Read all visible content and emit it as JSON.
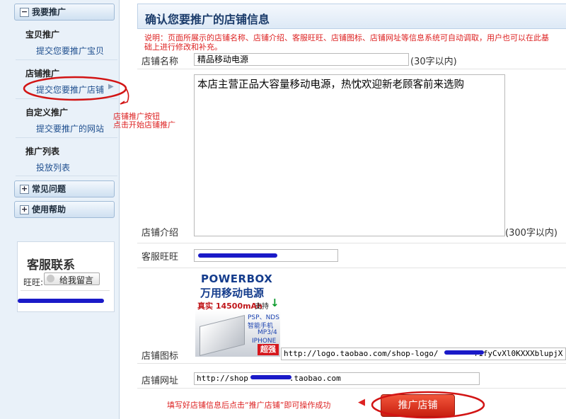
{
  "sidebar": {
    "promote_header": "我要推广",
    "sections": [
      {
        "title": "宝贝推广",
        "link": "提交您要推广宝贝"
      },
      {
        "title": "店铺推广",
        "link": "提交您要推广店铺"
      },
      {
        "title": "自定义推广",
        "link": "提交要推广的网站"
      },
      {
        "title": "推广列表",
        "link": "投放列表"
      }
    ],
    "faq_header": "常见问题",
    "help_header": "使用帮助",
    "customer_service": {
      "title": "客服联系",
      "wangwang_label": "旺旺:",
      "message_button": "给我留言"
    }
  },
  "annotations": {
    "button_note_line1": "店铺推广按钮",
    "button_note_line2": "点击开始店铺推广",
    "bottom_note": "填写好店铺信息后点击“推广店铺”即可操作成功"
  },
  "main": {
    "title": "确认您要推广的店铺信息",
    "notice": "说明：页面所展示的店铺名称、店铺介绍、客服旺旺、店铺图标、店铺网址等信息系统可自动调取，用户也可以在此基础上进行修改和补充。",
    "shop_name": {
      "label": "店铺名称",
      "value": "精品移动电源",
      "hint": "(30字以内)"
    },
    "shop_intro": {
      "label": "店铺介绍",
      "value": "本店主营正品大容量移动电源，热忱欢迎新老顾客前来选购",
      "hint": "(300字以内)"
    },
    "wangwang": {
      "label": "客服旺旺"
    },
    "shop_icon": {
      "label": "店铺图标",
      "url_start": "http://logo.taobao.com/shop-logo/",
      "url_end": "f1fyCvXl0KXXXblupjX",
      "image": {
        "brand": "POWERBOX",
        "title": "万用移动电源",
        "line": "真实 14500mAh",
        "support": "支持",
        "devices": [
          "PSP、NDS",
          "智能手机",
          "MP3/4",
          "IPHONE"
        ],
        "badge": "超强"
      }
    },
    "shop_url": {
      "label": "店铺网址",
      "prefix": "http://shop",
      "suffix": ".taobao.com"
    },
    "submit_button": "推广店铺"
  }
}
